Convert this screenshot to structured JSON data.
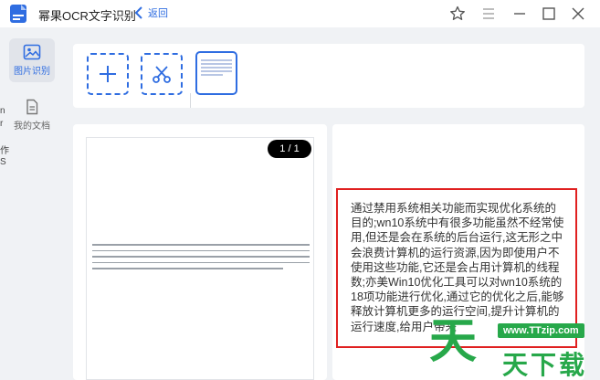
{
  "app": {
    "title": "幂果OCR文字识别",
    "back_label": "返回"
  },
  "sidebar": {
    "items": [
      {
        "label": "图片识别",
        "icon": "image-icon",
        "active": true
      },
      {
        "label": "我的文档",
        "icon": "document-icon",
        "active": false
      }
    ],
    "edge_fragments": [
      "n",
      "r",
      "作",
      "S"
    ]
  },
  "toolbar": {
    "add_icon": "plus-icon",
    "crop_icon": "scissors-icon"
  },
  "preview": {
    "page_indicator": "1 / 1"
  },
  "result": {
    "text": "通过禁用系统相关功能而实现优化系统的目的;wn10系统中有很多功能虽然不经常使用,但还是会在系统的后台运行,这无形之中会浪费计算机的运行资源,因为即使用户不使用这些功能,它还是会占用计算机的线程数;亦美Win10优化工具可以对wn10系统的18项功能进行优化,通过它的优化之后,能够释放计算机更多的运行空间,提升计算机的运行速度,给用户带来"
  },
  "watermark": {
    "url": "www.TTzip.com",
    "big_char": "天",
    "small_text": "天下载"
  },
  "colors": {
    "accent": "#2f6de1",
    "border_red": "#e02020",
    "watermark_green": "#27a84a"
  }
}
